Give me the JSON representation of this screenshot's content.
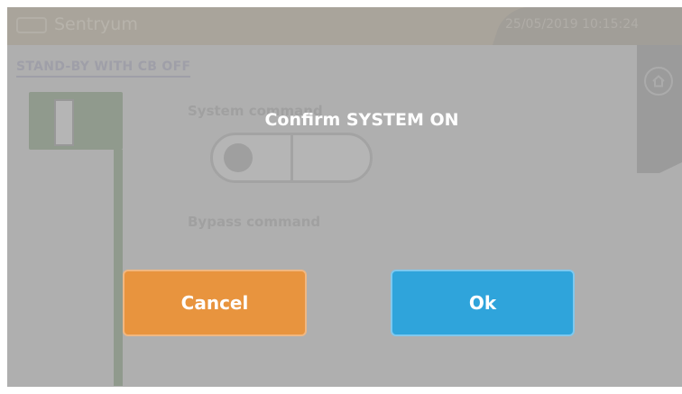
{
  "header": {
    "brand_name": "Sentryum",
    "datetime": "25/05/2019 10:15:24",
    "bg_color": "#b3ac9e"
  },
  "status": {
    "title": "STAND-BY WITH CB OFF"
  },
  "controls": {
    "system_label": "System command",
    "bypass_label": "Bypass command"
  },
  "icons": {
    "brand": "brand-logo-icon",
    "home": "home-icon"
  },
  "dialog": {
    "title": "Confirm SYSTEM ON",
    "cancel_label": "Cancel",
    "ok_label": "Ok",
    "cancel_color": "#e8943e",
    "ok_color": "#2fa4db"
  }
}
